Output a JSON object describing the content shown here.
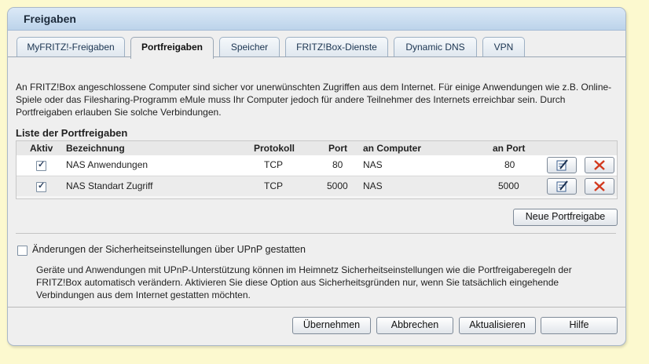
{
  "panel": {
    "title": "Freigaben"
  },
  "tabs": [
    {
      "label": "MyFRITZ!-Freigaben",
      "active": false
    },
    {
      "label": "Portfreigaben",
      "active": true
    },
    {
      "label": "Speicher",
      "active": false
    },
    {
      "label": "FRITZ!Box-Dienste",
      "active": false
    },
    {
      "label": "Dynamic DNS",
      "active": false
    },
    {
      "label": "VPN",
      "active": false
    }
  ],
  "intro_text": "An FRITZ!Box angeschlossene Computer sind sicher vor unerwünschten Zugriffen aus dem Internet. Für einige Anwendungen wie z.B. Online-Spiele oder das Filesharing-Programm eMule muss Ihr Computer jedoch für andere Teilnehmer des Internets erreichbar sein. Durch Portfreigaben erlauben Sie solche Verbindungen.",
  "list_title": "Liste der Portfreigaben",
  "table": {
    "headers": {
      "active": "Aktiv",
      "name": "Bezeichnung",
      "protocol": "Protokoll",
      "port": "Port",
      "computer": "an Computer",
      "to_port": "an Port"
    },
    "rows": [
      {
        "active": true,
        "name": "NAS Anwendungen",
        "protocol": "TCP",
        "port": "80",
        "computer": "NAS",
        "to_port": "80"
      },
      {
        "active": true,
        "name": "NAS Standart Zugriff",
        "protocol": "TCP",
        "port": "5000",
        "computer": "NAS",
        "to_port": "5000"
      }
    ],
    "edit_icon": "edit-icon",
    "delete_icon": "delete-icon"
  },
  "new_button": "Neue Portfreigabe",
  "upnp": {
    "checked": false,
    "label": "Änderungen der Sicherheitseinstellungen über UPnP gestatten",
    "description": "Geräte und Anwendungen mit UPnP-Unterstützung können im Heimnetz Sicherheitseinstellungen wie die Portfreigaberegeln der FRITZ!Box automatisch verändern. Aktivieren Sie diese Option aus Sicherheitsgründen nur, wenn Sie tatsächlich eingehende Verbindungen aus dem Internet gestatten möchten."
  },
  "footer_buttons": {
    "apply": "Übernehmen",
    "cancel": "Abbrechen",
    "refresh": "Aktualisieren",
    "help": "Hilfe"
  },
  "colors": {
    "background": "#fcf9cf",
    "header_gradient_top": "#dbe9f7",
    "header_gradient_bottom": "#bcd3ea",
    "delete_red": "#d23a1f",
    "edit_blue": "#3b5f8f"
  }
}
